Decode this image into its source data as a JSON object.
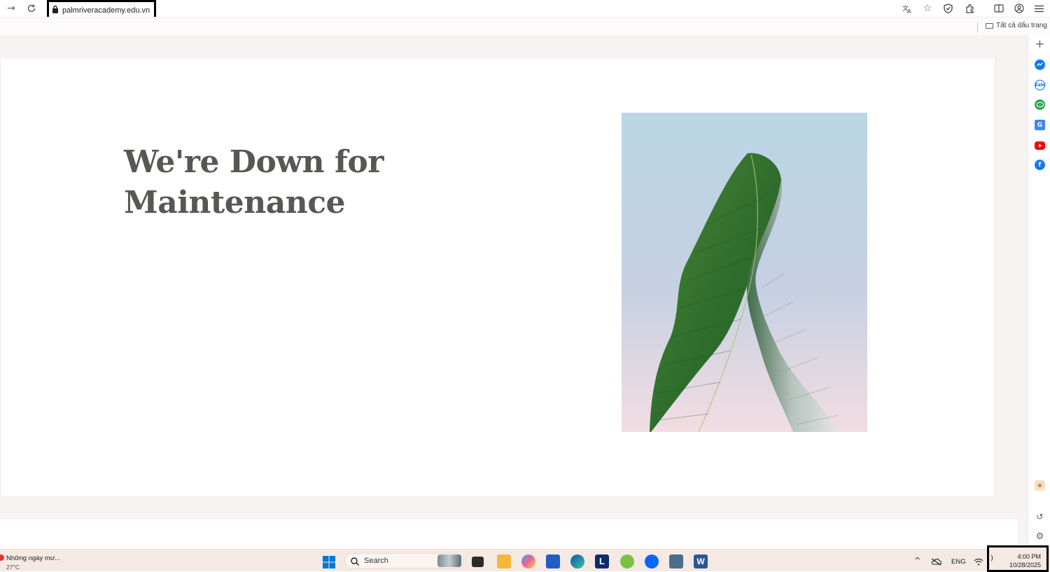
{
  "browser": {
    "url": "palmriveracademy.edu.vn",
    "bookmarks_folder_label": "Tất cả dấu trang"
  },
  "page": {
    "headline_line1": "We're Down for",
    "headline_line2": "Maintenance"
  },
  "sidepanel": {
    "icons": [
      "add-icon",
      "messenger-icon",
      "zalo-icon",
      "game-icon",
      "translate-icon",
      "youtube-icon",
      "facebook-icon",
      "extension-icon",
      "history-icon",
      "settings-icon"
    ]
  },
  "taskbar": {
    "weather_title": "Những ngày mư...",
    "weather_temp": "27°C",
    "search_placeholder": "Search",
    "language": "ENG",
    "time": "4:00 PM",
    "date": "10/28/2025"
  },
  "colors": {
    "headline": "#575753",
    "page_background": "#f7f3f3",
    "taskbar": "#f4e9e3",
    "youtube": "#ff0000",
    "facebook": "#1877f2",
    "messenger": "#0a7cff"
  }
}
